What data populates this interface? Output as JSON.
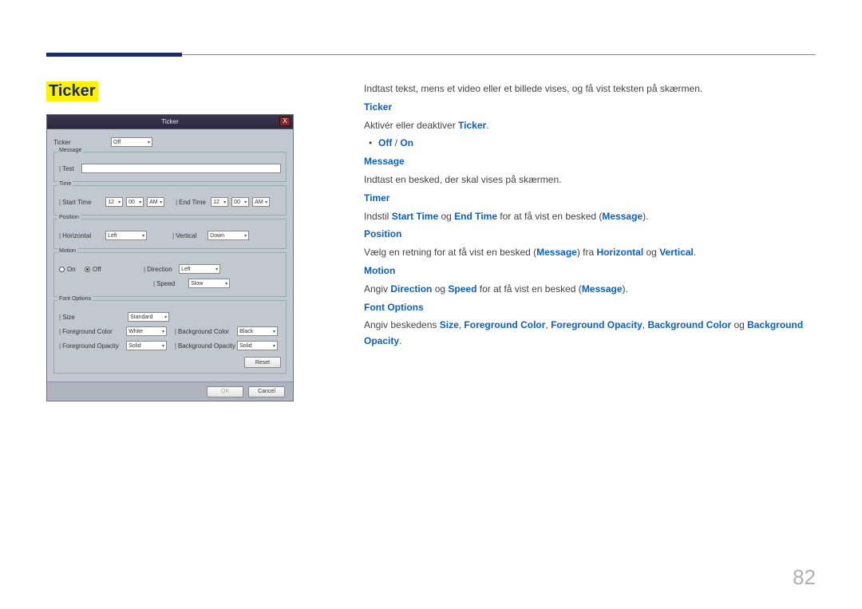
{
  "pageNumber": "82",
  "heading": "Ticker",
  "dialog": {
    "title": "Ticker",
    "close": "X",
    "tickerLabel": "Ticker",
    "tickerValue": "Off",
    "message": {
      "legend": "Message",
      "valueLabel": "Test"
    },
    "time": {
      "legend": "Time",
      "startLabel": "Start Time",
      "start_h": "12",
      "start_m": "00",
      "start_ampm": "AM",
      "endLabel": "End Time",
      "end_h": "12",
      "end_m": "00",
      "end_ampm": "AM"
    },
    "position": {
      "legend": "Position",
      "horizLabel": "Horizontal",
      "horizValue": "Left",
      "vertLabel": "Vertical",
      "vertValue": "Down"
    },
    "motion": {
      "legend": "Motion",
      "onLabel": "On",
      "offLabel": "Off",
      "dirLabel": "Direction",
      "dirValue": "Left",
      "speedLabel": "Speed",
      "speedValue": "Slow"
    },
    "font": {
      "legend": "Font Options",
      "sizeLabel": "Size",
      "sizeValue": "Standard",
      "fgColorLabel": "Foreground Color",
      "fgColorValue": "White",
      "bgColorLabel": "Background Color",
      "bgColorValue": "Black",
      "fgOpLabel": "Foreground Opacity",
      "fgOpValue": "Solid",
      "bgOpLabel": "Background Opacity",
      "bgOpValue": "Solid",
      "resetLabel": "Reset"
    },
    "okLabel": "OK",
    "cancelLabel": "Cancel"
  },
  "text": {
    "intro": "Indtast tekst, mens et video eller et billede vises, og få vist teksten på skærmen.",
    "ticker": {
      "h": "Ticker",
      "p1a": "Aktivér eller deaktiver ",
      "p1b": "Ticker",
      "p1c": ".",
      "off": "Off",
      "slash": " / ",
      "on": "On"
    },
    "message": {
      "h": "Message",
      "p": "Indtast en besked, der skal vises på skærmen."
    },
    "timer": {
      "h": "Timer",
      "a": "Indstil ",
      "b": "Start Time",
      "c": " og ",
      "d": "End Time",
      "e": " for at få vist en besked (",
      "f": "Message",
      "g": ")."
    },
    "position": {
      "h": "Position",
      "a": "Vælg en retning for at få vist en besked (",
      "b": "Message",
      "c": ") fra ",
      "d": "Horizontal",
      "e": " og ",
      "f": "Vertical",
      "g": "."
    },
    "motion": {
      "h": "Motion",
      "a": "Angiv ",
      "b": "Direction",
      "c": " og ",
      "d": "Speed",
      "e": " for at få vist en besked (",
      "f": "Message",
      "g": ")."
    },
    "fontopt": {
      "h": "Font Options",
      "a": "Angiv beskedens ",
      "b": "Size",
      "c": ", ",
      "d": "Foreground Color",
      "e": ", ",
      "f": "Foreground Opacity",
      "g": ", ",
      "hh": "Background Color",
      "i": " og ",
      "j": "Background Opacity",
      "k": "."
    }
  }
}
